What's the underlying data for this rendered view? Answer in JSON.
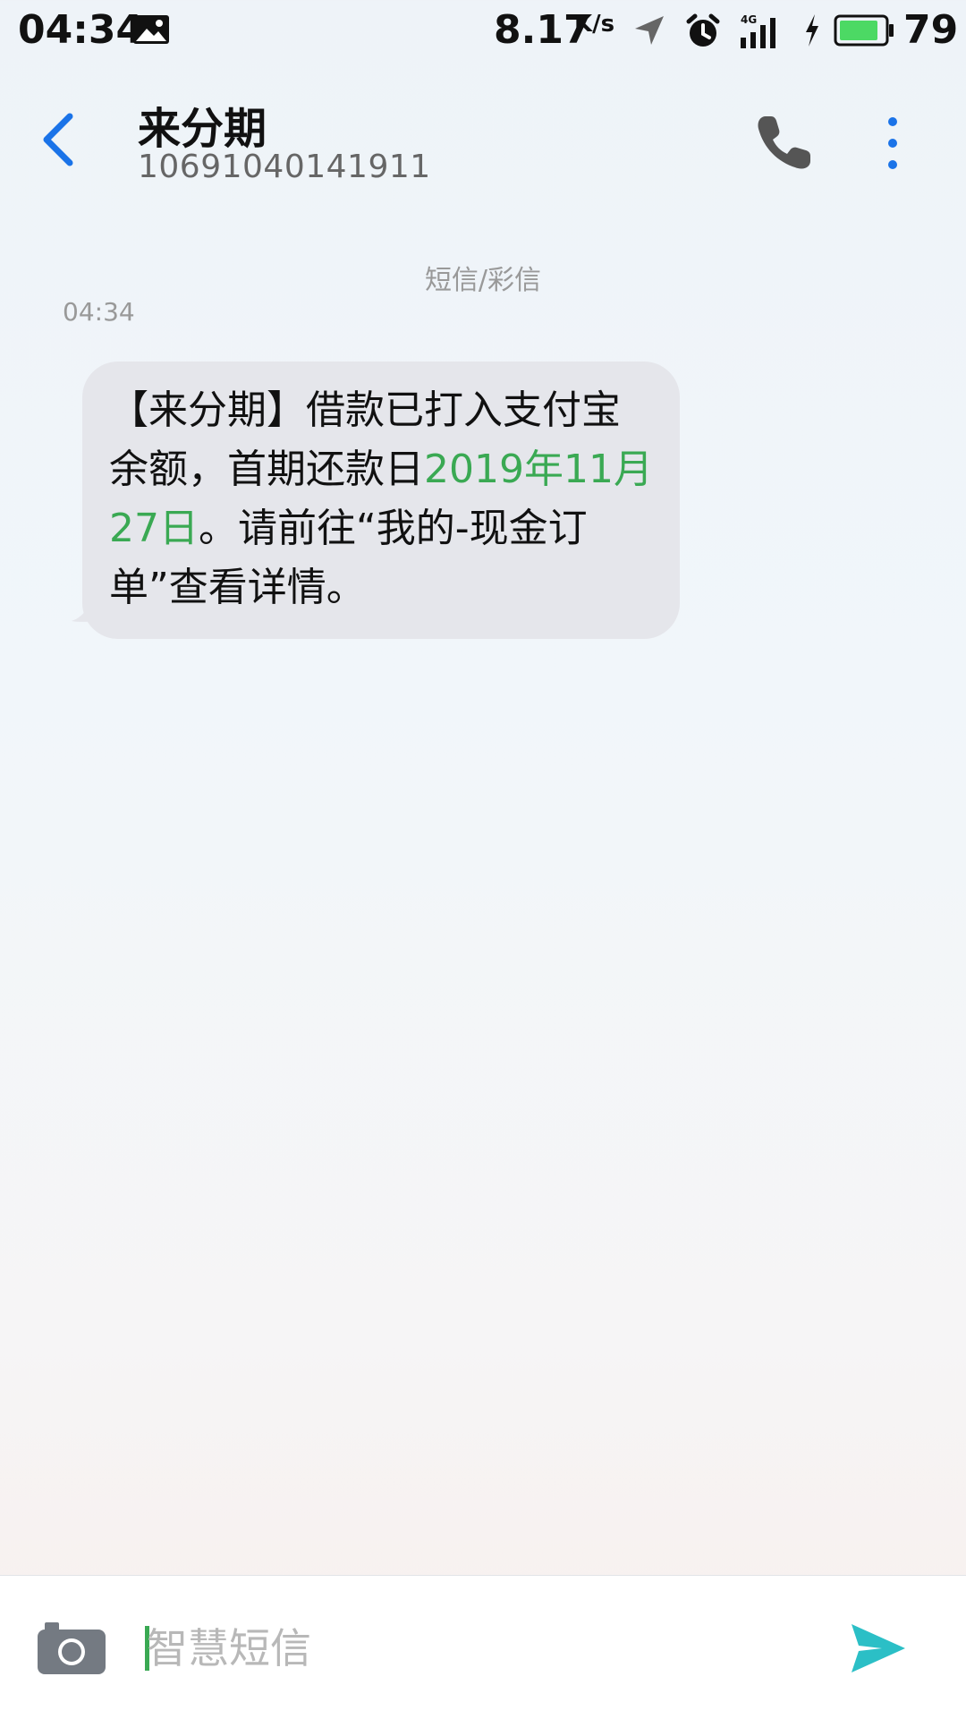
{
  "status_bar": {
    "time": "04:34",
    "net_speed": "8.17",
    "net_speed_unit": "K/s",
    "battery_level": "79",
    "network_type": "4G",
    "icons": [
      "image-notification-icon",
      "location-arrow-icon",
      "alarm-clock-icon",
      "signal-icon",
      "charging-icon",
      "battery-icon"
    ],
    "battery_color": "#4cd964"
  },
  "header": {
    "contact_name": "来分期",
    "contact_number": "10691040141911",
    "icons": [
      "back-chevron-icon",
      "phone-icon",
      "more-vertical-icon"
    ],
    "accent_color": "#1a73e8"
  },
  "conversation": {
    "channel_label": "短信/彩信",
    "messages": [
      {
        "time": "04:34",
        "text_before": "【来分期】借款已打入支付宝余额，首期还款日",
        "highlight": "2019年11月27日",
        "text_after": "。请前往“我的-现金订单”查看详情。",
        "highlight_color": "#3aa953"
      }
    ]
  },
  "composer": {
    "placeholder": "智慧短信",
    "value": "",
    "icons": [
      "camera-icon",
      "send-icon"
    ],
    "send_color": "#2bbfc6"
  }
}
